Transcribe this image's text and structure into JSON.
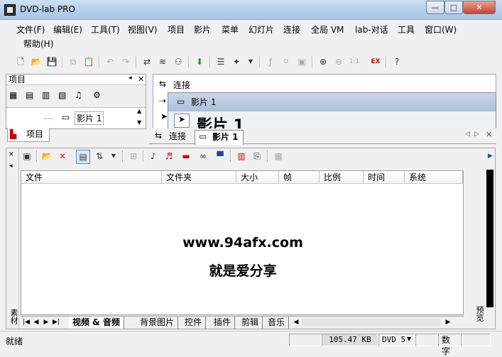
{
  "window": {
    "title": "DVD-lab PRO",
    "minimize": "—",
    "maximize": "□",
    "close": "✕"
  },
  "menu": [
    "文件(F)",
    "编辑(E)",
    "工具(T)",
    "视图(V)",
    "项目",
    "影片",
    "菜单",
    "幻灯片",
    "连接",
    "全局 VM",
    "lab-对话",
    "工具",
    "窗口(W)",
    "帮助(H)"
  ],
  "project_panel": {
    "title": "项目",
    "tree_item": "影片 1",
    "tab_label": "项目"
  },
  "connection": {
    "title": "连接",
    "movie_title": "影片 1",
    "movie_heading": "影片 1"
  },
  "doc_tabs": [
    {
      "label": "连接"
    },
    {
      "label": "影片 1"
    }
  ],
  "asset_panel": {
    "columns": [
      "文件",
      "文件夹",
      "大小",
      "帧",
      "比例",
      "时间",
      "系统"
    ],
    "watermark_line1": "www.94afx.com",
    "watermark_line2": "就是爱分享",
    "left_label": "素材",
    "right_label": "预览",
    "bottom_tabs": [
      "视频 & 音频",
      "背景图片",
      "控件",
      "插件",
      "剪辑",
      "音乐"
    ]
  },
  "status": {
    "left": "就绪",
    "size": "105.47 KB",
    "disc": "DVD 5",
    "mode": "数字"
  },
  "colors": {
    "title_bg": "#b9d1ec",
    "close_btn": "#c7442b",
    "panel_bg": "#f0f0f0"
  }
}
